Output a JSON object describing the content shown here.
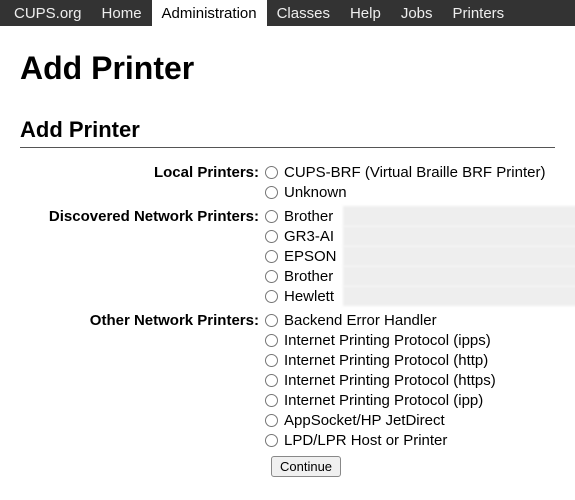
{
  "nav": {
    "items": [
      {
        "label": "CUPS.org",
        "active": false
      },
      {
        "label": "Home",
        "active": false
      },
      {
        "label": "Administration",
        "active": true
      },
      {
        "label": "Classes",
        "active": false
      },
      {
        "label": "Help",
        "active": false
      },
      {
        "label": "Jobs",
        "active": false
      },
      {
        "label": "Printers",
        "active": false
      }
    ]
  },
  "page": {
    "title": "Add Printer",
    "section_title": "Add Printer"
  },
  "groups": {
    "local": {
      "label": "Local Printers:",
      "options": [
        "CUPS-BRF (Virtual Braille BRF Printer)",
        "Unknown"
      ]
    },
    "discovered": {
      "label": "Discovered Network Printers:",
      "options": [
        "Brother",
        "GR3-AI",
        "EPSON",
        "Brother",
        "Hewlett"
      ]
    },
    "other": {
      "label": "Other Network Printers:",
      "options": [
        "Backend Error Handler",
        "Internet Printing Protocol (ipps)",
        "Internet Printing Protocol (http)",
        "Internet Printing Protocol (https)",
        "Internet Printing Protocol (ipp)",
        "AppSocket/HP JetDirect",
        "LPD/LPR Host or Printer"
      ]
    }
  },
  "buttons": {
    "continue": "Continue"
  }
}
